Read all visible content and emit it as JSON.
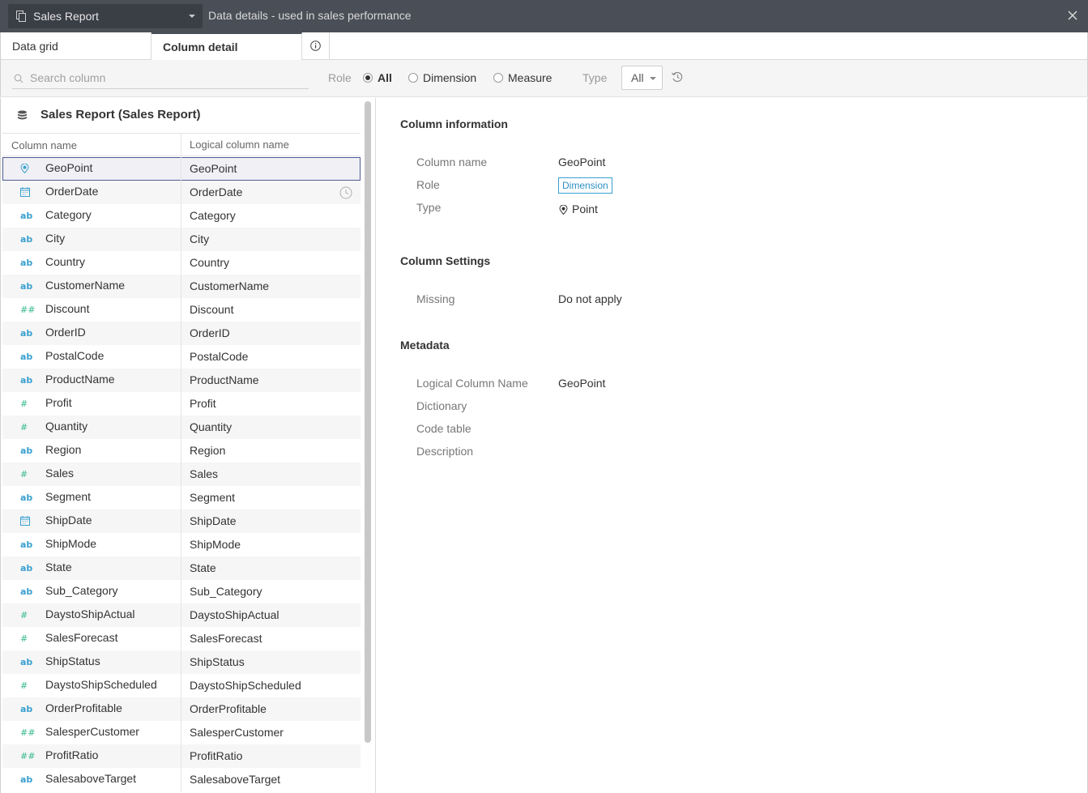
{
  "titlebar": {
    "datasource": "Sales Report",
    "title": "Data details - used in sales performance"
  },
  "tabs": {
    "grid": "Data grid",
    "detail": "Column detail"
  },
  "filter": {
    "search_placeholder": "Search column",
    "role_label": "Role",
    "role_options": [
      "All",
      "Dimension",
      "Measure"
    ],
    "role_selected": "All",
    "type_label": "Type",
    "type_value": "All"
  },
  "left": {
    "datasource_name": "Sales Report (Sales Report)",
    "col_header_name": "Column name",
    "col_header_logical": "Logical column name",
    "rows": [
      {
        "name": "GeoPoint",
        "logical": "GeoPoint",
        "icon": "geo-pin-icon"
      },
      {
        "name": "OrderDate",
        "logical": "OrderDate",
        "icon": "calendar-icon"
      },
      {
        "name": "Category",
        "logical": "Category",
        "icon": "text-icon"
      },
      {
        "name": "City",
        "logical": "City",
        "icon": "text-icon"
      },
      {
        "name": "Country",
        "logical": "Country",
        "icon": "text-icon"
      },
      {
        "name": "CustomerName",
        "logical": "CustomerName",
        "icon": "text-icon"
      },
      {
        "name": "Discount",
        "logical": "Discount",
        "icon": "decimal-icon"
      },
      {
        "name": "OrderID",
        "logical": "OrderID",
        "icon": "text-icon"
      },
      {
        "name": "PostalCode",
        "logical": "PostalCode",
        "icon": "text-icon"
      },
      {
        "name": "ProductName",
        "logical": "ProductName",
        "icon": "text-icon"
      },
      {
        "name": "Profit",
        "logical": "Profit",
        "icon": "number-icon"
      },
      {
        "name": "Quantity",
        "logical": "Quantity",
        "icon": "number-icon"
      },
      {
        "name": "Region",
        "logical": "Region",
        "icon": "text-icon"
      },
      {
        "name": "Sales",
        "logical": "Sales",
        "icon": "number-icon"
      },
      {
        "name": "Segment",
        "logical": "Segment",
        "icon": "text-icon"
      },
      {
        "name": "ShipDate",
        "logical": "ShipDate",
        "icon": "calendar-icon"
      },
      {
        "name": "ShipMode",
        "logical": "ShipMode",
        "icon": "text-icon"
      },
      {
        "name": "State",
        "logical": "State",
        "icon": "text-icon"
      },
      {
        "name": "Sub_Category",
        "logical": "Sub_Category",
        "icon": "text-icon"
      },
      {
        "name": "DaystoShipActual",
        "logical": "DaystoShipActual",
        "icon": "number-icon"
      },
      {
        "name": "SalesForecast",
        "logical": "SalesForecast",
        "icon": "number-icon"
      },
      {
        "name": "ShipStatus",
        "logical": "ShipStatus",
        "icon": "text-icon"
      },
      {
        "name": "DaystoShipScheduled",
        "logical": "DaystoShipScheduled",
        "icon": "number-icon"
      },
      {
        "name": "OrderProfitable",
        "logical": "OrderProfitable",
        "icon": "text-icon"
      },
      {
        "name": "SalesperCustomer",
        "logical": "SalesperCustomer",
        "icon": "decimal-icon"
      },
      {
        "name": "ProfitRatio",
        "logical": "ProfitRatio",
        "icon": "decimal-icon"
      },
      {
        "name": "SalesaboveTarget",
        "logical": "SalesaboveTarget",
        "icon": "text-icon"
      }
    ]
  },
  "detail": {
    "sec_info": "Column information",
    "label_colname": "Column name",
    "value_colname": "GeoPoint",
    "label_role": "Role",
    "value_role": "Dimension",
    "label_type": "Type",
    "value_type": "Point",
    "sec_settings": "Column Settings",
    "label_missing": "Missing",
    "value_missing": "Do not apply",
    "sec_meta": "Metadata",
    "label_logical": "Logical Column Name",
    "value_logical": "GeoPoint",
    "label_dictionary": "Dictionary",
    "label_codetable": "Code table",
    "label_description": "Description"
  },
  "colors": {
    "titlebar": "#4a4f57",
    "accent_blue": "#3aa0d0",
    "accent_green": "#36b88e",
    "selection_border": "#4f5b93"
  }
}
